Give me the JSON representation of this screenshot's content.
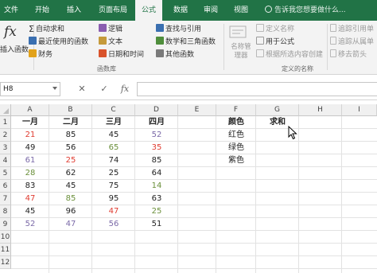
{
  "tabs": [
    {
      "label": "文件",
      "active": false
    },
    {
      "label": "开始",
      "active": false
    },
    {
      "label": "插入",
      "active": false
    },
    {
      "label": "页面布局",
      "active": false
    },
    {
      "label": "公式",
      "active": true
    },
    {
      "label": "数据",
      "active": false
    },
    {
      "label": "审阅",
      "active": false
    },
    {
      "label": "视图",
      "active": false
    }
  ],
  "tell_me": "告诉我您想要做什么...",
  "ribbon": {
    "insert_function": "插入函数",
    "function_library": {
      "autosum": "自动求和",
      "recent": "最近使用的函数",
      "financial": "财务",
      "logical": "逻辑",
      "text": "文本",
      "datetime": "日期和时间",
      "lookup": "查找与引用",
      "math": "数学和三角函数",
      "more": "其他函数",
      "label": "函数库"
    },
    "defined_names": {
      "name_manager": "名称管理器",
      "define_name": "定义名称",
      "use_in_formula": "用于公式",
      "create_from_selection": "根据所选内容创建",
      "label": "定义的名称"
    },
    "formula_auditing": {
      "trace_precedents": "追踪引用单",
      "trace_dependents": "追踪从属单",
      "remove_arrows": "移去箭头"
    }
  },
  "formula_bar": {
    "name_box": "H8",
    "cancel": "✕",
    "enter": "✓",
    "fx": "fx",
    "content": ""
  },
  "sheet": {
    "columns": [
      "A",
      "B",
      "C",
      "D",
      "E",
      "F",
      "G",
      "H",
      "I"
    ],
    "rows": [
      "1",
      "2",
      "3",
      "4",
      "5",
      "6",
      "7",
      "8",
      "9",
      "10",
      "11",
      "12"
    ],
    "headers": {
      "A": "一月",
      "B": "二月",
      "C": "三月",
      "D": "四月"
    },
    "data": [
      [
        {
          "v": "21",
          "c": "#e03c31"
        },
        {
          "v": "85",
          "c": "#222222"
        },
        {
          "v": "45",
          "c": "#222222"
        },
        {
          "v": "52",
          "c": "#7b6aa8"
        }
      ],
      [
        {
          "v": "49",
          "c": "#222222"
        },
        {
          "v": "56",
          "c": "#222222"
        },
        {
          "v": "65",
          "c": "#6a8f3a"
        },
        {
          "v": "35",
          "c": "#e03c31"
        }
      ],
      [
        {
          "v": "61",
          "c": "#7b6aa8"
        },
        {
          "v": "25",
          "c": "#e03c31"
        },
        {
          "v": "74",
          "c": "#222222"
        },
        {
          "v": "85",
          "c": "#222222"
        }
      ],
      [
        {
          "v": "28",
          "c": "#6a8f3a"
        },
        {
          "v": "62",
          "c": "#222222"
        },
        {
          "v": "25",
          "c": "#222222"
        },
        {
          "v": "64",
          "c": "#222222"
        }
      ],
      [
        {
          "v": "83",
          "c": "#222222"
        },
        {
          "v": "45",
          "c": "#222222"
        },
        {
          "v": "75",
          "c": "#222222"
        },
        {
          "v": "14",
          "c": "#6a8f3a"
        }
      ],
      [
        {
          "v": "47",
          "c": "#e03c31"
        },
        {
          "v": "85",
          "c": "#6a8f3a"
        },
        {
          "v": "95",
          "c": "#222222"
        },
        {
          "v": "63",
          "c": "#222222"
        }
      ],
      [
        {
          "v": "45",
          "c": "#222222"
        },
        {
          "v": "96",
          "c": "#222222"
        },
        {
          "v": "47",
          "c": "#e03c31"
        },
        {
          "v": "25",
          "c": "#6a8f3a"
        }
      ],
      [
        {
          "v": "52",
          "c": "#7b6aa8"
        },
        {
          "v": "47",
          "c": "#7b6aa8"
        },
        {
          "v": "56",
          "c": "#7b6aa8"
        },
        {
          "v": "51",
          "c": "#222222"
        }
      ]
    ],
    "f_header": "颜色",
    "g_header": "求和",
    "colors": [
      "红色",
      "绿色",
      "紫色"
    ]
  },
  "accent": "#217346"
}
